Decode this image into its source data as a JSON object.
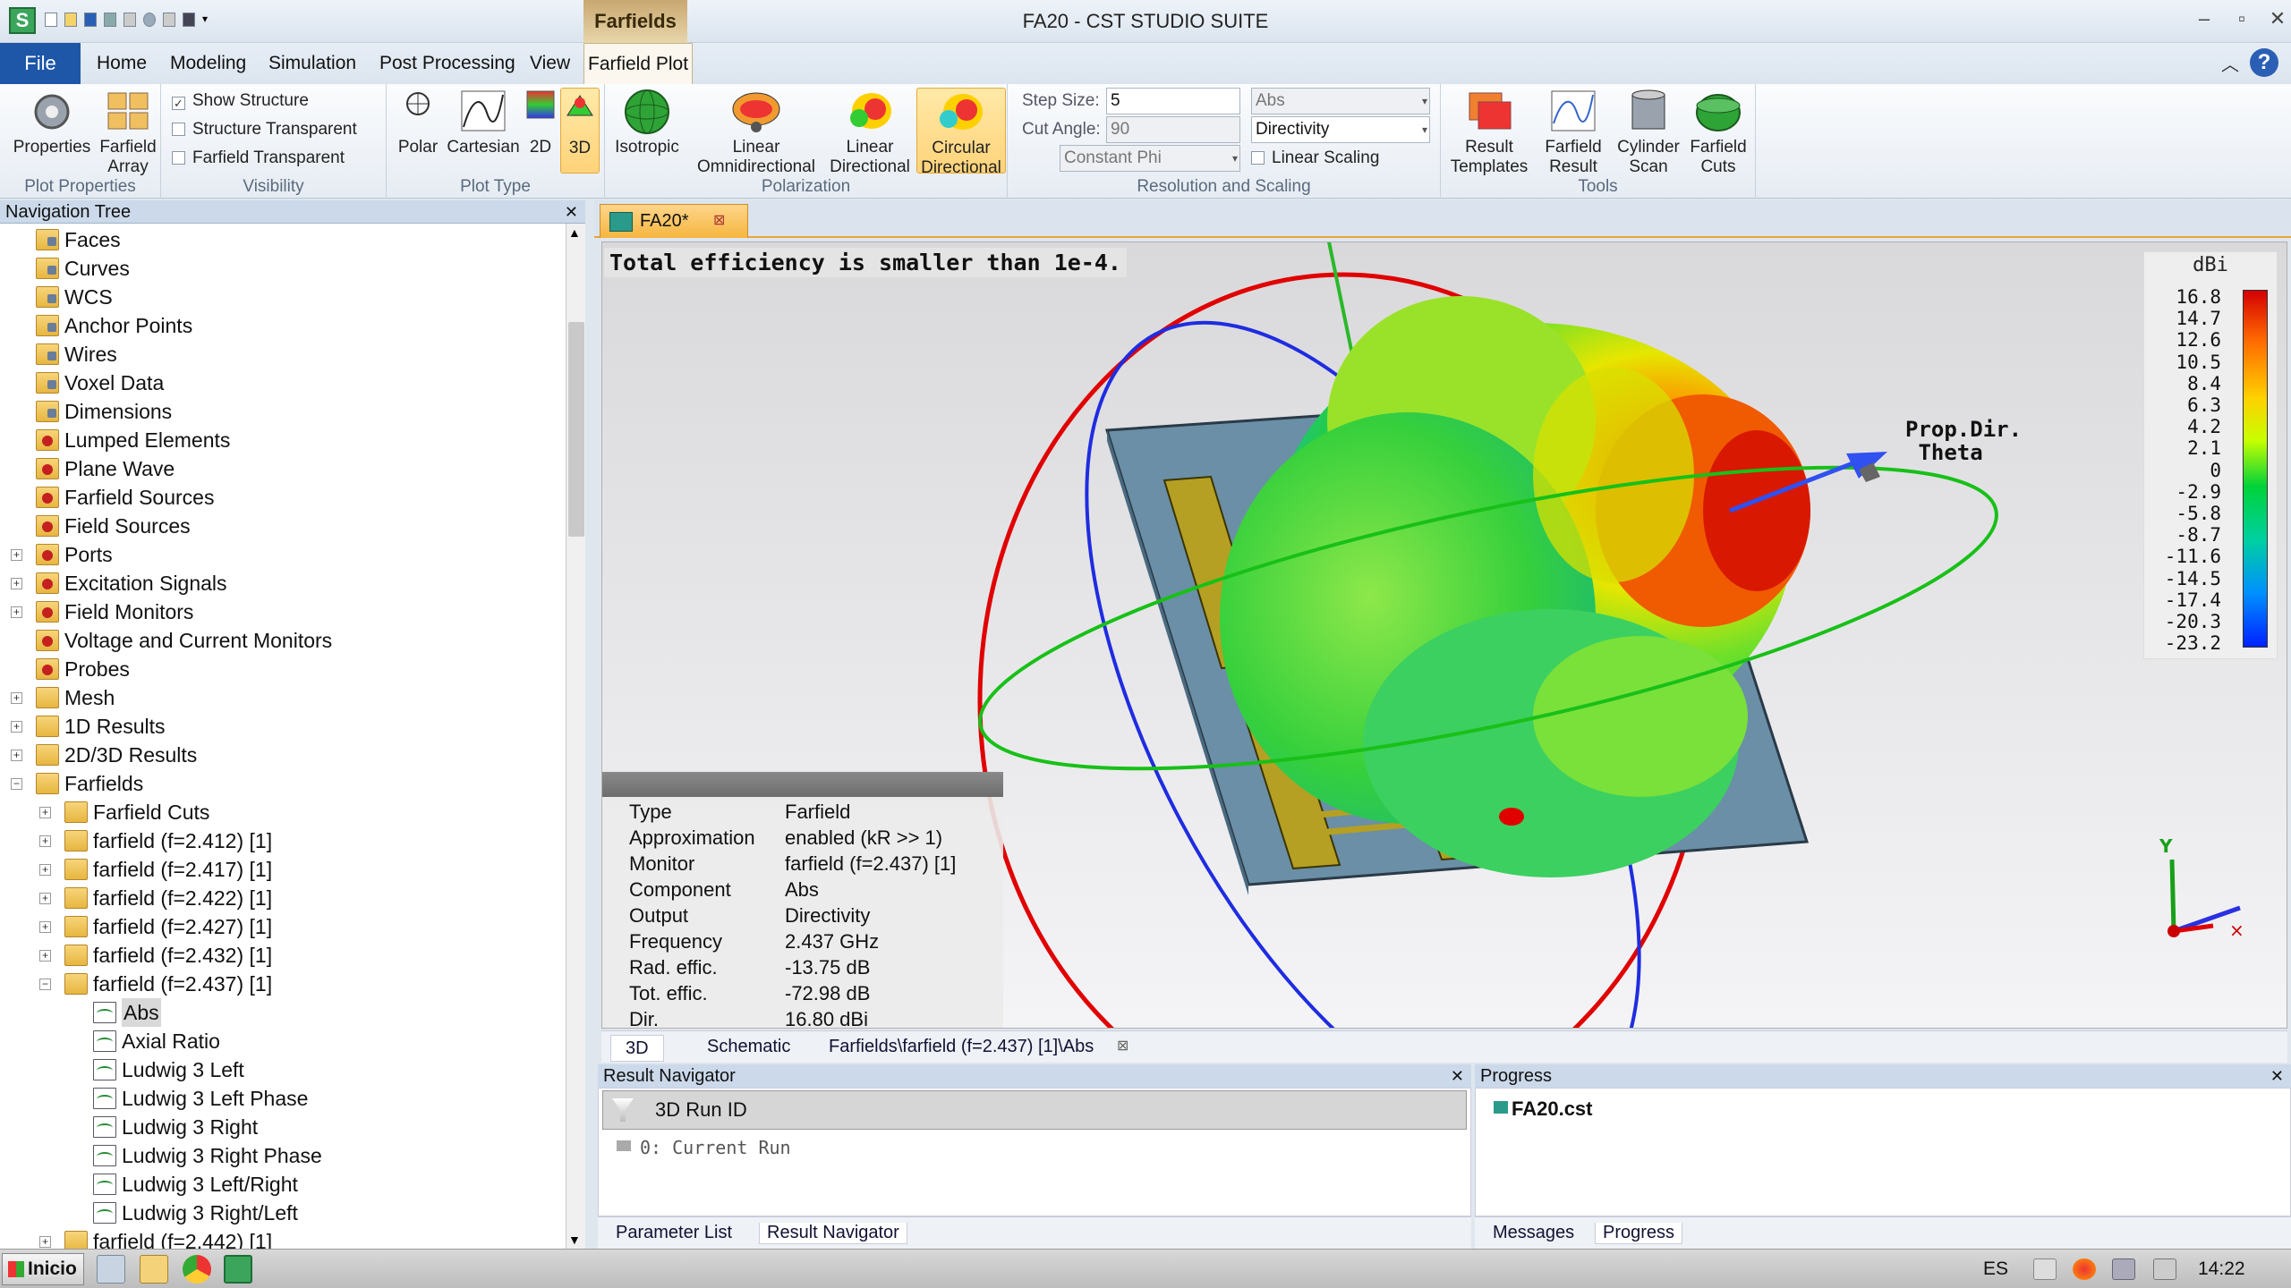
{
  "window": {
    "title": "FA20 - CST STUDIO SUITE",
    "context_group": "Farfields"
  },
  "tabs": {
    "file": "File",
    "home": "Home",
    "modeling": "Modeling",
    "simulation": "Simulation",
    "post": "Post Processing",
    "view": "View",
    "farfield_plot": "Farfield Plot"
  },
  "ribbon": {
    "plot_properties": {
      "label": "Plot Properties",
      "properties": "Properties",
      "farfield_array_1": "Farfield",
      "farfield_array_2": "Array"
    },
    "visibility": {
      "label": "Visibility",
      "show_structure": "Show Structure",
      "structure_transparent": "Structure Transparent",
      "farfield_transparent": "Farfield Transparent",
      "show_structure_checked": "✓"
    },
    "plot_type": {
      "label": "Plot Type",
      "polar": "Polar",
      "cartesian": "Cartesian",
      "2d": "2D",
      "3d": "3D"
    },
    "polarization": {
      "label": "Polarization",
      "isotropic": "Isotropic",
      "lin_omni_1": "Linear",
      "lin_omni_2": "Omnidirectional",
      "lin_dir_1": "Linear",
      "lin_dir_2": "Directional",
      "circ_dir_1": "Circular",
      "circ_dir_2": "Directional"
    },
    "resolution": {
      "label": "Resolution and Scaling",
      "step_label": "Step Size:",
      "step_value": "5",
      "cut_label": "Cut Angle:",
      "cut_value": "90",
      "cut_mode": "Constant Phi",
      "abs_value": "Abs",
      "output_value": "Directivity",
      "linear_scaling": "Linear Scaling"
    },
    "tools": {
      "label": "Tools",
      "result_templates_1": "Result",
      "result_templates_2": "Templates",
      "farfield_result_1": "Farfield",
      "farfield_result_2": "Result",
      "cylinder_scan_1": "Cylinder",
      "cylinder_scan_2": "Scan",
      "farfield_cuts_1": "Farfield",
      "farfield_cuts_2": "Cuts"
    }
  },
  "nav": {
    "title": "Navigation Tree",
    "items": [
      {
        "label": "Faces"
      },
      {
        "label": "Curves"
      },
      {
        "label": "WCS"
      },
      {
        "label": "Anchor Points"
      },
      {
        "label": "Wires"
      },
      {
        "label": "Voxel Data"
      },
      {
        "label": "Dimensions"
      },
      {
        "label": "Lumped Elements"
      },
      {
        "label": "Plane Wave"
      },
      {
        "label": "Farfield Sources"
      },
      {
        "label": "Field Sources"
      },
      {
        "label": "Ports"
      },
      {
        "label": "Excitation Signals"
      },
      {
        "label": "Field Monitors"
      },
      {
        "label": "Voltage and Current Monitors"
      },
      {
        "label": "Probes"
      },
      {
        "label": "Mesh"
      },
      {
        "label": "1D Results"
      },
      {
        "label": "2D/3D Results"
      },
      {
        "label": "Farfields"
      },
      {
        "label": "Farfield Cuts"
      },
      {
        "label": "farfield (f=2.412) [1]"
      },
      {
        "label": "farfield (f=2.417) [1]"
      },
      {
        "label": "farfield (f=2.422) [1]"
      },
      {
        "label": "farfield (f=2.427) [1]"
      },
      {
        "label": "farfield (f=2.432) [1]"
      },
      {
        "label": "farfield (f=2.437) [1]"
      },
      {
        "label": "Abs"
      },
      {
        "label": "Axial Ratio"
      },
      {
        "label": "Ludwig 3 Left"
      },
      {
        "label": "Ludwig 3 Left Phase"
      },
      {
        "label": "Ludwig 3 Right"
      },
      {
        "label": "Ludwig 3 Right Phase"
      },
      {
        "label": "Ludwig 3 Left/Right"
      },
      {
        "label": "Ludwig 3 Right/Left"
      },
      {
        "label": "farfield (f=2.442) [1]"
      }
    ]
  },
  "document": {
    "tab": "FA20*",
    "message": "Total efficiency is smaller than 1e-4."
  },
  "legend": {
    "unit": "dBi",
    "values": [
      "16.8",
      "14.7",
      "12.6",
      "10.5",
      "8.4",
      "6.3",
      "4.2",
      "2.1",
      "0",
      "-2.9",
      "-5.8",
      "-8.7",
      "-11.6",
      "-14.5",
      "-17.4",
      "-20.3",
      "-23.2"
    ]
  },
  "prop_dir": {
    "line1": "Prop.Dir.",
    "line2": "Theta"
  },
  "axes": {
    "y": "Y"
  },
  "info": [
    {
      "key": "Type",
      "value": "Farfield"
    },
    {
      "key": "Approximation",
      "value": "enabled (kR >> 1)"
    },
    {
      "key": "Monitor",
      "value": "farfield (f=2.437) [1]"
    },
    {
      "key": "Component",
      "value": "Abs"
    },
    {
      "key": "Output",
      "value": "Directivity"
    },
    {
      "key": "Frequency",
      "value": "2.437 GHz"
    },
    {
      "key": "Rad. effic.",
      "value": "-13.75 dB"
    },
    {
      "key": "Tot. effic.",
      "value": "-72.98 dB"
    },
    {
      "key": "Dir.",
      "value": "16.80 dBi"
    }
  ],
  "view_tabs": {
    "t3d": "3D",
    "schematic": "Schematic",
    "path": "Farfields\\farfield (f=2.437) [1]\\Abs"
  },
  "result_nav": {
    "title": "Result Navigator",
    "column": "3D Run ID",
    "row": "0: Current Run",
    "tab1": "Parameter List",
    "tab2": "Result Navigator"
  },
  "progress": {
    "title": "Progress",
    "file": "FA20.cst",
    "tab1": "Messages",
    "tab2": "Progress"
  },
  "taskbar": {
    "start": "Inicio",
    "lang": "ES",
    "time": "14:22"
  },
  "colors": {
    "accent": "#1e56a8",
    "active_tool": "#ffd37a"
  }
}
